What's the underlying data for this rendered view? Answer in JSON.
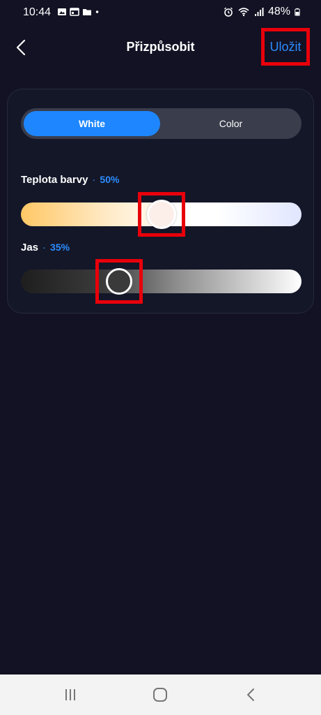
{
  "status_bar": {
    "time": "10:44",
    "battery": "48%",
    "icons": [
      "image-icon",
      "calendar-icon",
      "folder-icon",
      "notification-dot-icon",
      "alarm-icon",
      "wifi-icon",
      "signal-icon",
      "battery-icon"
    ]
  },
  "header": {
    "title": "Přizpůsobit",
    "save_label": "Uložit",
    "back_icon": "chevron-left-icon"
  },
  "mode_toggle": {
    "options": [
      {
        "label": "White",
        "selected": true
      },
      {
        "label": "Color",
        "selected": false
      }
    ]
  },
  "sliders": {
    "temperature": {
      "label": "Teplota barvy",
      "separator": "·",
      "value_text": "50%",
      "value": 50
    },
    "brightness": {
      "label": "Jas",
      "separator": "·",
      "value_text": "35%",
      "value": 35
    }
  },
  "nav_bar": {
    "items": [
      "recent-apps-icon",
      "home-icon",
      "back-icon"
    ]
  },
  "colors": {
    "accent": "#1e87ff",
    "link": "#2d8cff",
    "background": "#121224",
    "highlight": "#e8000b"
  }
}
